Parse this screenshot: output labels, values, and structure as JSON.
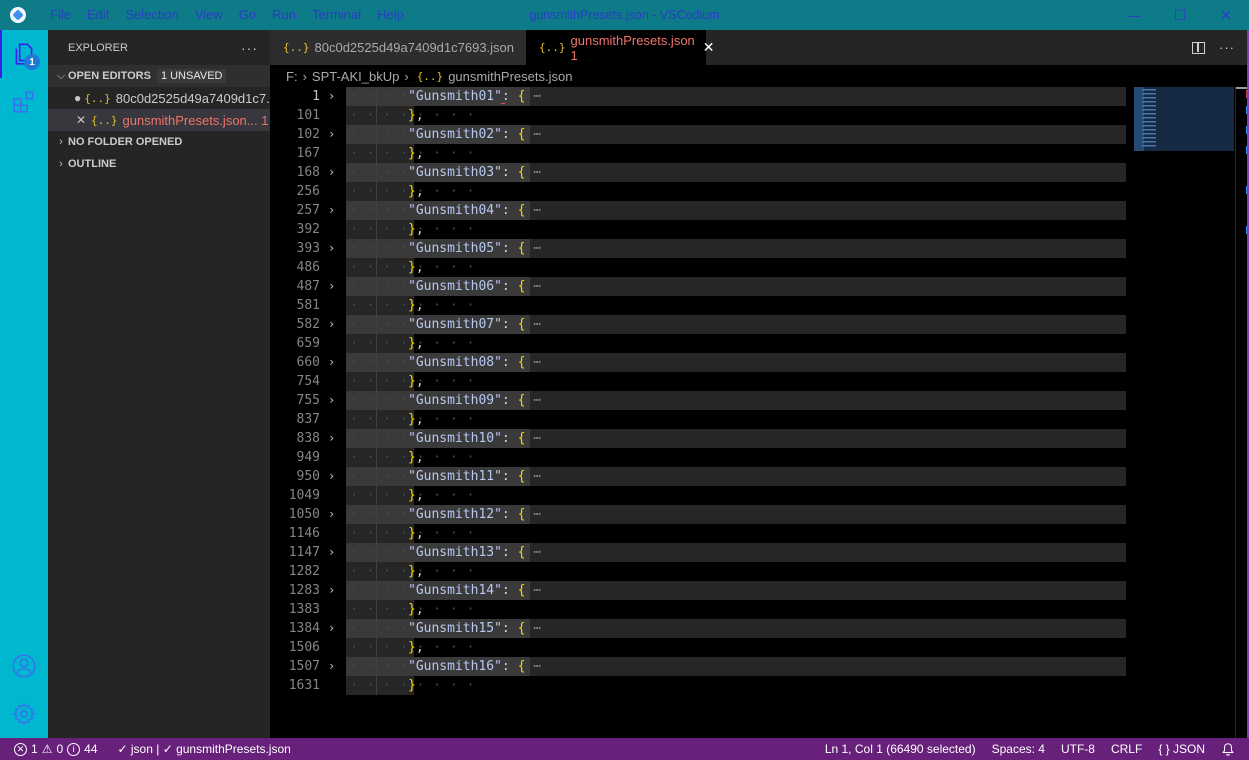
{
  "titlebar": {
    "menu": [
      "File",
      "Edit",
      "Selection",
      "View",
      "Go",
      "Run",
      "Terminal",
      "Help"
    ],
    "window_title": "gunsmithPresets.json - VSCodium",
    "minimize": "—",
    "maximize": "☐",
    "close": "✕"
  },
  "activitybar": {
    "explorer_badge": "1"
  },
  "sidebar": {
    "title": "EXPLORER",
    "more": "···",
    "open_editors": {
      "label": "OPEN EDITORS",
      "badge": "1 UNSAVED",
      "files": [
        {
          "name": "80c0d2525d49a7409d1c7...",
          "state": "modified",
          "lead": "●"
        },
        {
          "name": "gunsmithPresets.json... 1",
          "state": "error",
          "lead": "✕"
        }
      ]
    },
    "no_folder": "NO FOLDER OPENED",
    "outline": "OUTLINE"
  },
  "tabs": [
    {
      "name": "80c0d2525d49a7409d1c7693.json",
      "active": false,
      "modified": true
    },
    {
      "name": "gunsmithPresets.json 1",
      "active": true,
      "close": "✕"
    }
  ],
  "breadcrumb": [
    "F:",
    "SPT-AKI_bkUp",
    "gunsmithPresets.json"
  ],
  "json_icon": "{..}",
  "code": {
    "whitespace": "· · · · · · · ·",
    "lines": [
      {
        "num": "1",
        "type": "open",
        "key": "\"Gunsmith01\"",
        "current": true
      },
      {
        "num": "101",
        "type": "close",
        "text": "},"
      },
      {
        "num": "102",
        "type": "open",
        "key": "\"Gunsmith02\""
      },
      {
        "num": "167",
        "type": "close",
        "text": "},"
      },
      {
        "num": "168",
        "type": "open",
        "key": "\"Gunsmith03\""
      },
      {
        "num": "256",
        "type": "close",
        "text": "},"
      },
      {
        "num": "257",
        "type": "open",
        "key": "\"Gunsmith04\""
      },
      {
        "num": "392",
        "type": "close",
        "text": "},"
      },
      {
        "num": "393",
        "type": "open",
        "key": "\"Gunsmith05\""
      },
      {
        "num": "486",
        "type": "close",
        "text": "},"
      },
      {
        "num": "487",
        "type": "open",
        "key": "\"Gunsmith06\""
      },
      {
        "num": "581",
        "type": "close",
        "text": "},"
      },
      {
        "num": "582",
        "type": "open",
        "key": "\"Gunsmith07\""
      },
      {
        "num": "659",
        "type": "close",
        "text": "},"
      },
      {
        "num": "660",
        "type": "open",
        "key": "\"Gunsmith08\""
      },
      {
        "num": "754",
        "type": "close",
        "text": "},"
      },
      {
        "num": "755",
        "type": "open",
        "key": "\"Gunsmith09\""
      },
      {
        "num": "837",
        "type": "close",
        "text": "},"
      },
      {
        "num": "838",
        "type": "open",
        "key": "\"Gunsmith10\""
      },
      {
        "num": "949",
        "type": "close",
        "text": "},"
      },
      {
        "num": "950",
        "type": "open",
        "key": "\"Gunsmith11\""
      },
      {
        "num": "1049",
        "type": "close",
        "text": "},"
      },
      {
        "num": "1050",
        "type": "open",
        "key": "\"Gunsmith12\""
      },
      {
        "num": "1146",
        "type": "close",
        "text": "},"
      },
      {
        "num": "1147",
        "type": "open",
        "key": "\"Gunsmith13\""
      },
      {
        "num": "1282",
        "type": "close",
        "text": "},"
      },
      {
        "num": "1283",
        "type": "open",
        "key": "\"Gunsmith14\""
      },
      {
        "num": "1383",
        "type": "close",
        "text": "},"
      },
      {
        "num": "1384",
        "type": "open",
        "key": "\"Gunsmith15\""
      },
      {
        "num": "1506",
        "type": "close",
        "text": "},"
      },
      {
        "num": "1507",
        "type": "open",
        "key": "\"Gunsmith16\""
      },
      {
        "num": "1631",
        "type": "last",
        "text": "}"
      }
    ]
  },
  "statusbar": {
    "errors": "1",
    "warnings": "0",
    "infos": "44",
    "validation": "✓ json | ✓ gunsmithPresets.json",
    "position": "Ln 1, Col 1 (66490 selected)",
    "spaces": "Spaces: 4",
    "encoding": "UTF-8",
    "eol": "CRLF",
    "language": "{ } JSON"
  },
  "colors": {
    "titlebar": "#0e7c88",
    "activitybar": "#00b7d0",
    "statusbar": "#68217a",
    "error_text": "#f0736b",
    "brace": "#ffd700"
  }
}
